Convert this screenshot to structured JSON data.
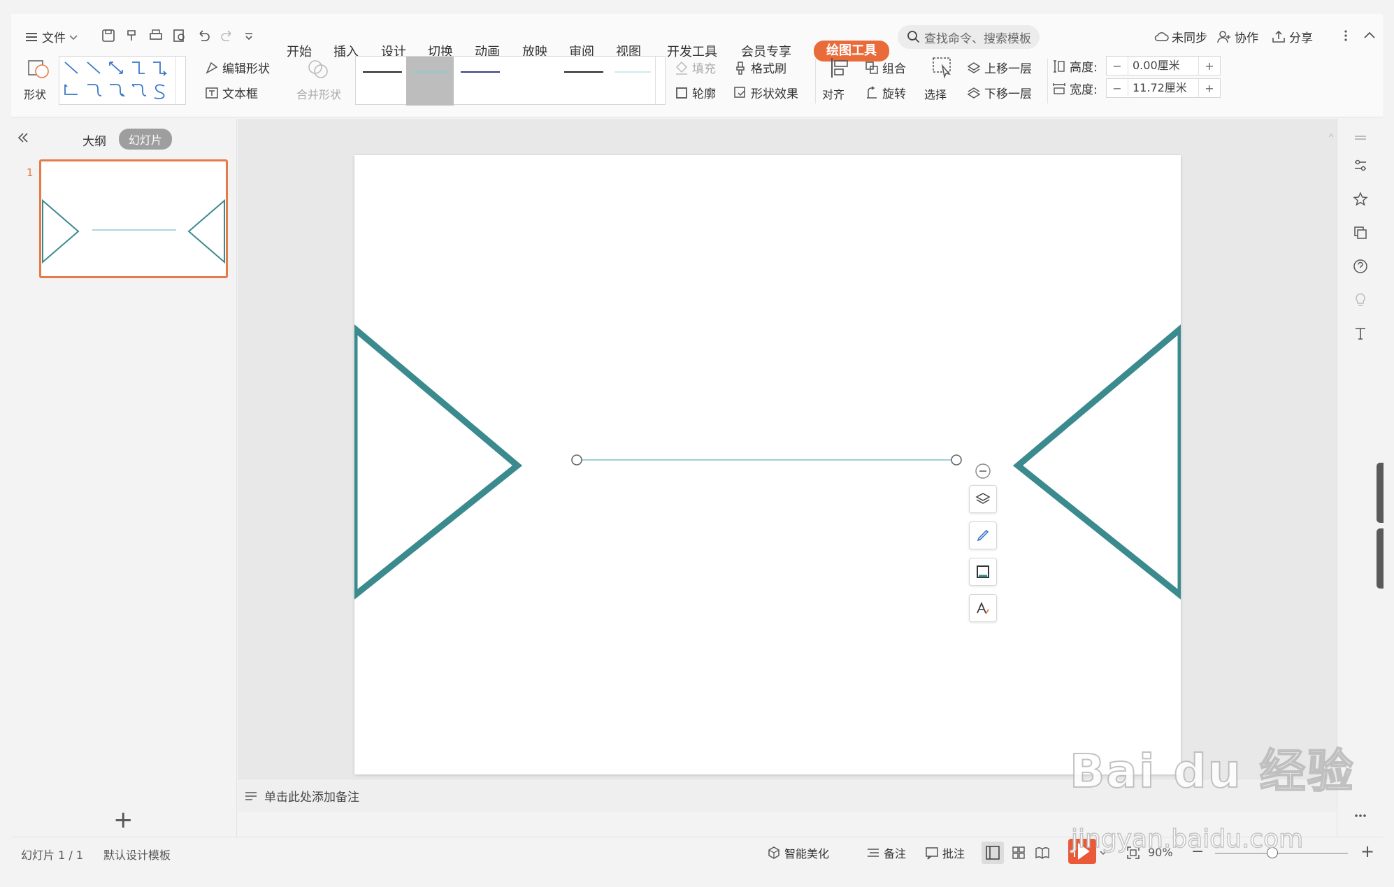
{
  "menu": {
    "file_label": "文件"
  },
  "tabs": [
    {
      "label": "开始"
    },
    {
      "label": "插入"
    },
    {
      "label": "设计"
    },
    {
      "label": "切换"
    },
    {
      "label": "动画"
    },
    {
      "label": "放映"
    },
    {
      "label": "审阅"
    },
    {
      "label": "视图"
    },
    {
      "label": "开发工具"
    },
    {
      "label": "会员专享"
    },
    {
      "label": "绘图工具"
    }
  ],
  "search": {
    "placeholder": "查找命令、搜索模板"
  },
  "topright": {
    "sync": "未同步",
    "collab": "协作",
    "share": "分享"
  },
  "ribbon": {
    "shape": "形状",
    "edit_shape": "编辑形状",
    "textbox": "文本框",
    "merge_shape": "合并形状",
    "fill": "填充",
    "format_painter": "格式刷",
    "outline": "轮廓",
    "shape_effect": "形状效果",
    "align": "对齐",
    "group": "组合",
    "rotate": "旋转",
    "select": "选择",
    "bring_forward": "上移一层",
    "send_backward": "下移一层",
    "height_label": "高度:",
    "height_value": "0.00厘米",
    "width_label": "宽度:",
    "width_value": "11.72厘米",
    "minus": "−",
    "plus": "+"
  },
  "sidebar": {
    "outline_tab": "大纲",
    "slides_tab": "幻灯片",
    "slide_number": "1",
    "add": "+"
  },
  "notes": {
    "placeholder": "单击此处添加备注"
  },
  "status": {
    "slide_info": "幻灯片 1 / 1",
    "template": "默认设计模板",
    "beautify": "智能美化",
    "notes": "备注",
    "comment": "批注",
    "zoom": "90%",
    "zoom_minus": "−",
    "zoom_plus": "+"
  },
  "watermark": {
    "brand": "Bai du 经验",
    "url": "jingyan.baidu.com"
  },
  "colors": {
    "accent": "#ea6b3a",
    "shape_stroke": "#3a8a8e",
    "line": "#8fcad0"
  }
}
